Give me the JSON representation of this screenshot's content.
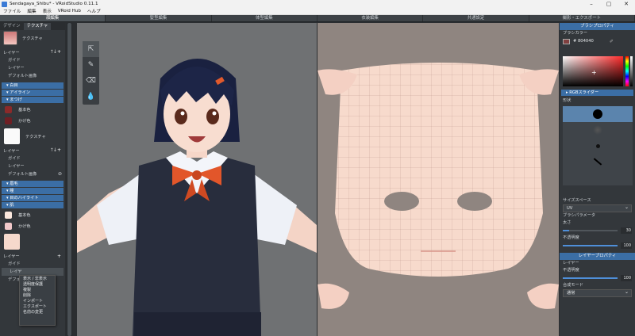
{
  "window": {
    "title": "Sendagaya_Shibu* - VRoidStudio 0.11.1"
  },
  "menu": [
    "ファイル",
    "編集",
    "表示",
    "VRoid Hub",
    "ヘルプ"
  ],
  "mode_tabs": [
    "顔編集",
    "髪型編集",
    "体型編集",
    "衣装編集",
    "共通設定",
    "撮影・エクスポート"
  ],
  "left_panel": {
    "tabs": [
      "デザイン",
      "テクスチャ"
    ],
    "top_texture_label": "テクスチャ",
    "layer_label": "レイヤー",
    "layer_items": [
      "ガイド",
      "レイヤー",
      "デフォルト画像"
    ],
    "sections_a": [
      "白目",
      "アイライン",
      "まつげ"
    ],
    "base_color_label": "基本色",
    "shadow_color_label": "かげ色",
    "texture_label": "テクスチャ",
    "layer_label2": "レイヤー",
    "layer_items2": [
      "ガイド",
      "レイヤー",
      "デフォルト画像"
    ],
    "sections_b": [
      "眉毛",
      "瞳",
      "目のハイライト",
      "肌"
    ],
    "skin_base_label": "基本色",
    "skin_shadow_label": "かげ色",
    "layer_label3": "レイヤー",
    "layer_items3": [
      "ガイド",
      "レイヤ",
      "デフォルト画像"
    ]
  },
  "context_menu": [
    "表示 / 非表示",
    "透明度保護",
    "複製",
    "削除",
    "インポート",
    "エクスポート",
    "名前の変更"
  ],
  "right_panel": {
    "brush_header": "ブラシプロパティ",
    "brush_color_label": "ブラシカラー",
    "hex_value": "# 804040",
    "rgb_slider_label": "RGBスライダー",
    "shape_label": "形状",
    "size_space_label": "サイズスペース",
    "size_space_value": "UV",
    "brush_param_label": "ブラシパラメータ",
    "thickness_label": "太さ",
    "thickness_value": "30",
    "opacity_label": "不透明度",
    "opacity_value": "100",
    "layer_header": "レイヤープロパティ",
    "layer_label": "レイヤー",
    "layer_opacity_label": "不透明度",
    "layer_opacity_value": "100",
    "blend_mode_label": "合成モード",
    "blend_mode_value": "通常"
  },
  "colors": {
    "brush_color": "#804040",
    "accent": "#3b6ea5",
    "skin": "#f6d9cc",
    "lash_base": "#8b2a2a",
    "lash_shadow": "#6e1f24",
    "skin_base": "#fbe8de",
    "skin_shadow": "#f1c8c9"
  },
  "icons": [
    "select-cursor-icon",
    "pen-icon",
    "eraser-icon",
    "fill-icon",
    "eyedropper-icon",
    "arrow-up-icon",
    "arrow-down-icon",
    "add-icon"
  ]
}
